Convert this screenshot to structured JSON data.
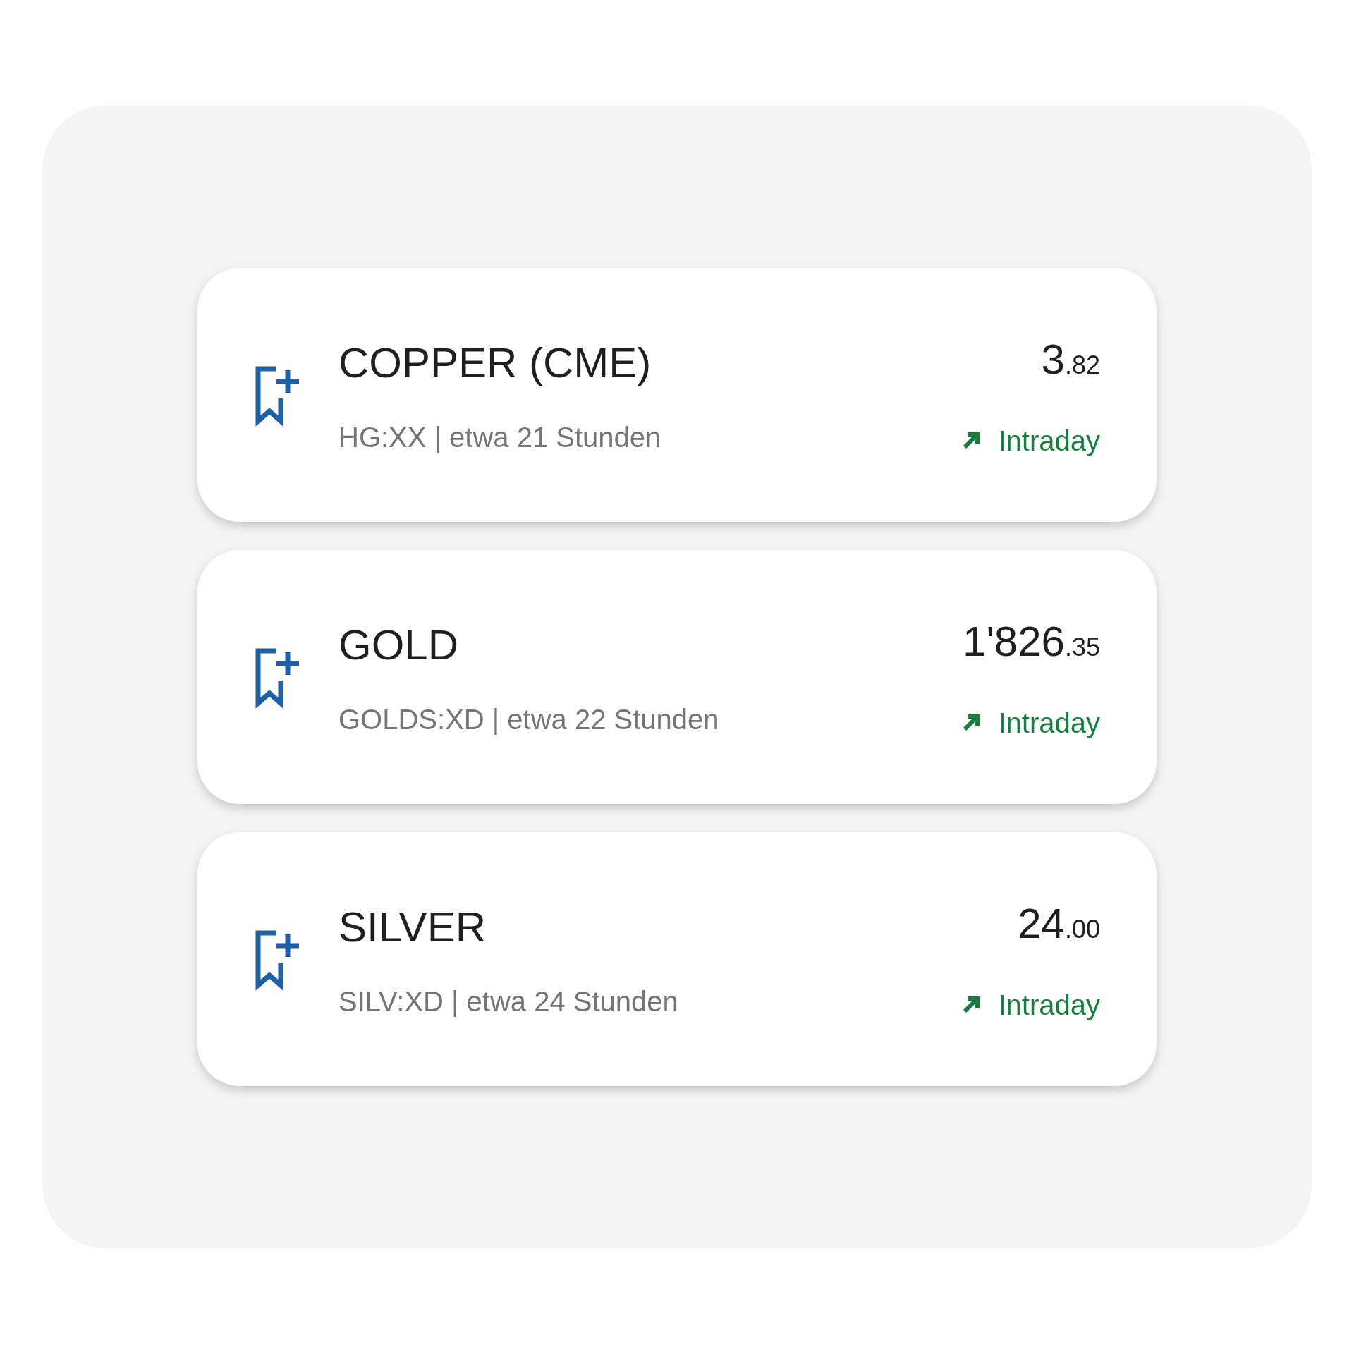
{
  "instruments": [
    {
      "name": "COPPER (CME)",
      "detail": "HG:XX | etwa 21 Stunden",
      "price": "3",
      "price_decimals": ".82",
      "kind": "up",
      "trend_label": "Intraday"
    },
    {
      "name": "GOLD",
      "detail": "GOLDS:XD | etwa 22 Stunden",
      "price": "1'826",
      "price_decimals": ".35",
      "kind": "up",
      "trend_label": "Intraday"
    },
    {
      "name": "SILVER",
      "detail": "SILV:XD | etwa 24 Stunden",
      "price": "24",
      "price_decimals": ".00",
      "kind": "up",
      "trend_label": "Intraday"
    }
  ]
}
